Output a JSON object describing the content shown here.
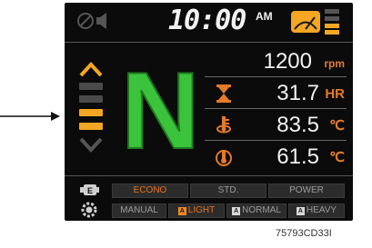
{
  "clock": {
    "time": "10:00",
    "ampm": "AM"
  },
  "status_icons": [
    "mute-speaker-icon",
    "wiper-icon",
    "fuel-level-icon"
  ],
  "gear": {
    "position": "N",
    "levels_lit": 2,
    "levels_total": 4
  },
  "readouts": [
    {
      "id": "engine-speed",
      "icon": "none",
      "value": "1200",
      "unit": "rpm"
    },
    {
      "id": "hour-meter",
      "icon": "hourglass-icon",
      "value": "31.7",
      "unit": "HR"
    },
    {
      "id": "fluid-temp",
      "icon": "coolant-temp-icon",
      "value": "83.5",
      "unit": "℃"
    },
    {
      "id": "oil-temp",
      "icon": "oil-temp-icon",
      "value": "61.5",
      "unit": "℃"
    }
  ],
  "power_mode": {
    "icon": "power-mode-icon",
    "options": [
      "ECONO",
      "STD.",
      "POWER"
    ],
    "active": "ECONO"
  },
  "shift_mode": {
    "icon": "gear-shift-icon",
    "options": [
      {
        "badge": "",
        "label": "MANUAL"
      },
      {
        "badge": "A",
        "label": "LIGHT"
      },
      {
        "badge": "A",
        "label": "NORMAL"
      },
      {
        "badge": "A",
        "label": "HEAVY"
      }
    ],
    "active": "LIGHT"
  },
  "caption": "75793CD33I",
  "colors": {
    "accent": "#f5a623",
    "gear_green": "#3cc33c",
    "unit_orange": "#e47a2a",
    "screen_bg": "#0b0b0b"
  }
}
